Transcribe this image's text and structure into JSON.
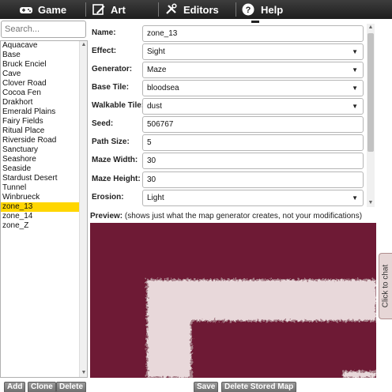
{
  "nav": {
    "items": [
      {
        "label": "Game",
        "icon": "gamepad-icon"
      },
      {
        "label": "Art",
        "icon": "paint-icon"
      },
      {
        "label": "Editors",
        "icon": "tools-icon"
      },
      {
        "label": "Help",
        "icon": "help-icon"
      }
    ]
  },
  "sidebar": {
    "search_placeholder": "Search...",
    "maps": [
      "Aquacave",
      "Base",
      "Bruck Enciel",
      "Cave",
      "Clover Road",
      "Cocoa Fen",
      "Drakhort",
      "Emerald Plains",
      "Fairy Fields",
      "Ritual Place",
      "Riverside Road",
      "Sanctuary",
      "Seashore",
      "Seaside",
      "Stardust Desert",
      "Tunnel",
      "Winbrueck",
      "zone_13",
      "zone_14",
      "zone_Z"
    ],
    "selected": "zone_13"
  },
  "form": {
    "name_label": "Name:",
    "name_value": "zone_13",
    "effect_label": "Effect:",
    "effect_value": "Sight",
    "generator_label": "Generator:",
    "generator_value": "Maze",
    "base_tile_label": "Base Tile:",
    "base_tile_value": "bloodsea",
    "walkable_tile_label": "Walkable Tile:",
    "walkable_tile_value": "dust",
    "seed_label": "Seed:",
    "seed_value": "506767",
    "path_size_label": "Path Size:",
    "path_size_value": "5",
    "maze_width_label": "Maze Width:",
    "maze_width_value": "30",
    "maze_height_label": "Maze Height:",
    "maze_height_value": "30",
    "erosion_label": "Erosion:",
    "erosion_value": "Light"
  },
  "preview": {
    "label_bold": "Preview:",
    "label_note": " (shows just what the map generator creates, not your modifications)",
    "base_color": "#6e1a35",
    "path_color": "#e8d8da"
  },
  "chat": {
    "label": "Click to chat"
  },
  "buttons": {
    "add": "Add",
    "clone": "Clone",
    "delete": "Delete",
    "save": "Save",
    "delete_stored": "Delete Stored Map"
  }
}
